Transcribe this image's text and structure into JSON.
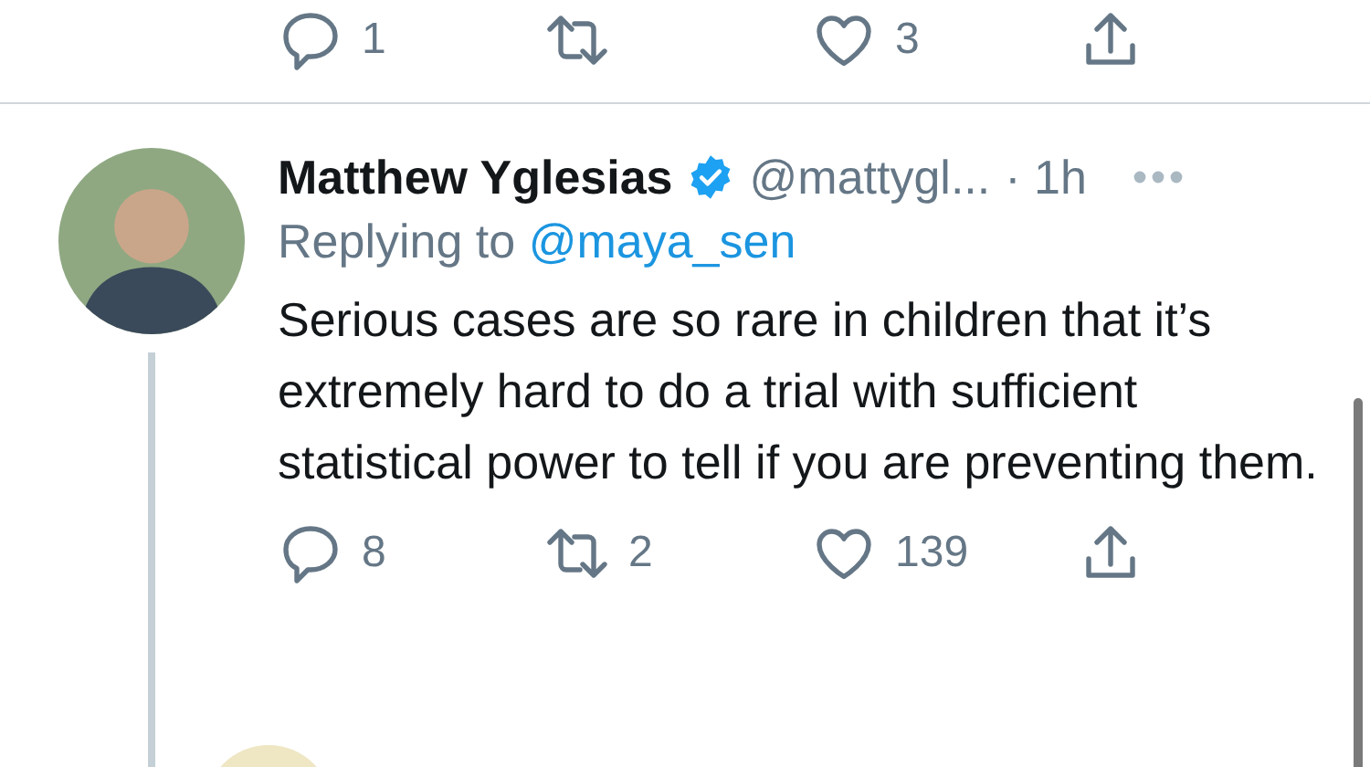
{
  "previous_tweet": {
    "actions": [
      {
        "kind": "reply",
        "count": "1"
      },
      {
        "kind": "retweet"
      },
      {
        "kind": "like",
        "count": "3"
      },
      {
        "kind": "share"
      }
    ]
  },
  "tweet": {
    "name": "Matthew Yglesias",
    "verified": true,
    "handle": "@mattygl...",
    "time": "· 1h",
    "replying_label": "Replying to",
    "replying_to": "@maya_sen",
    "text": "Serious cases are so rare in children that it’s extremely hard to do a trial with sufficient statistical power to tell if you are preventing them.",
    "actions": [
      {
        "kind": "reply",
        "count": "8"
      },
      {
        "kind": "retweet",
        "count": "2"
      },
      {
        "kind": "like",
        "count": "139"
      },
      {
        "kind": "share"
      }
    ]
  }
}
